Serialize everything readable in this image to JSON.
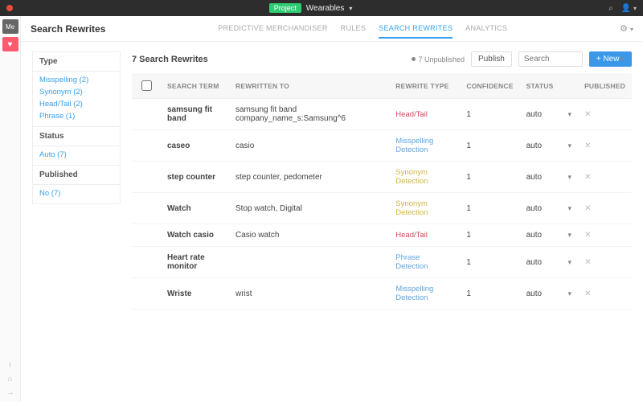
{
  "topbar": {
    "project_badge": "Project",
    "project_name": "Wearables",
    "me_label": "Me"
  },
  "header": {
    "title": "Search Rewrites",
    "tabs": [
      {
        "label": "PREDICTIVE MERCHANDISER",
        "active": false
      },
      {
        "label": "RULES",
        "active": false
      },
      {
        "label": "SEARCH REWRITES",
        "active": true
      },
      {
        "label": "ANALYTICS",
        "active": false
      }
    ]
  },
  "filters": {
    "groups": [
      {
        "title": "Type",
        "items": [
          "Misspelling (2)",
          "Synonym (2)",
          "Head/Tail (2)",
          "Phrase (1)"
        ]
      },
      {
        "title": "Status",
        "items": [
          "Auto (7)"
        ]
      },
      {
        "title": "Published",
        "items": [
          "No (7)"
        ]
      }
    ]
  },
  "toolbar": {
    "count_label": "7 Search Rewrites",
    "unpublished_label": "7 Unpublished",
    "publish_label": "Publish",
    "search_placeholder": "Search",
    "new_label": "+ New"
  },
  "table": {
    "columns": [
      "SEARCH TERM",
      "REWRITTEN TO",
      "REWRITE TYPE",
      "CONFIDENCE",
      "STATUS",
      "",
      "PUBLISHED"
    ],
    "rows": [
      {
        "term": "samsung fit band",
        "rewritten": "samsung fit band company_name_s:Samsung^6",
        "type": "Head/Tail",
        "type_class": "c-headtail",
        "confidence": "1",
        "status": "auto"
      },
      {
        "term": "caseo",
        "rewritten": "casio",
        "type": "Misspelling Detection",
        "type_class": "c-misspell",
        "confidence": "1",
        "status": "auto"
      },
      {
        "term": "step counter",
        "rewritten": "step counter, pedometer",
        "type": "Synonym Detection",
        "type_class": "c-synonym",
        "confidence": "1",
        "status": "auto"
      },
      {
        "term": "Watch",
        "rewritten": "Stop watch, Digital",
        "type": "Synonym Detection",
        "type_class": "c-synonym",
        "confidence": "1",
        "status": "auto"
      },
      {
        "term": "Watch casio",
        "rewritten": "Casio watch",
        "type": "Head/Tail",
        "type_class": "c-headtail",
        "confidence": "1",
        "status": "auto"
      },
      {
        "term": "Heart rate monitor",
        "rewritten": "",
        "type": "Phrase Detection",
        "type_class": "c-phrase",
        "confidence": "1",
        "status": "auto"
      },
      {
        "term": "Wriste",
        "rewritten": "wrist",
        "type": "Misspelling Detection",
        "type_class": "c-misspell",
        "confidence": "1",
        "status": "auto"
      }
    ]
  }
}
